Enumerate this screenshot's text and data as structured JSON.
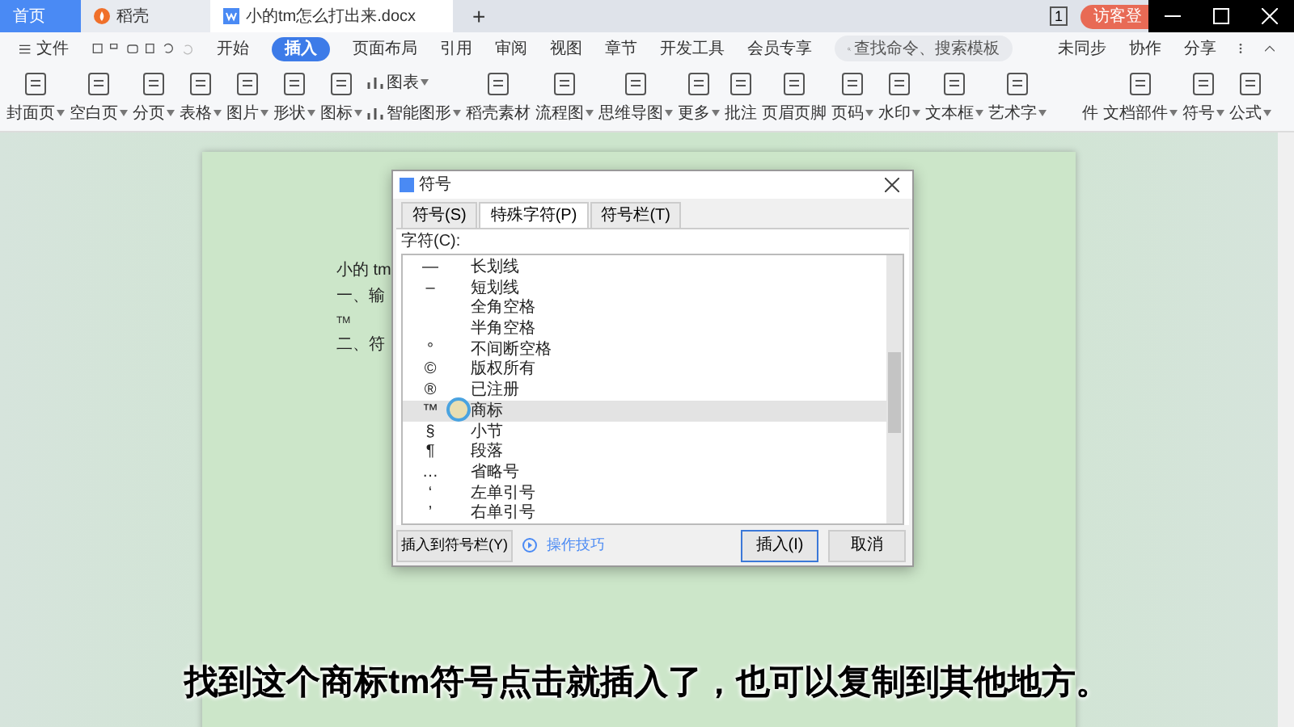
{
  "tabs": [
    {
      "label": "首页",
      "kind": "home",
      "selected": false
    },
    {
      "label": "稻壳",
      "kind": "app",
      "selected": false
    },
    {
      "label": "小的tm怎么打出来.docx",
      "kind": "doc",
      "selected": true
    }
  ],
  "new_tab": "+",
  "page_count": "1",
  "login": "访客登",
  "menu": {
    "file": "文件",
    "items": [
      {
        "label": "开始",
        "selected": false
      },
      {
        "label": "插入",
        "selected": true
      },
      {
        "label": "页面布局",
        "selected": false
      },
      {
        "label": "引用",
        "selected": false
      },
      {
        "label": "审阅",
        "selected": false
      },
      {
        "label": "视图",
        "selected": false
      },
      {
        "label": "章节",
        "selected": false
      },
      {
        "label": "开发工具",
        "selected": false
      },
      {
        "label": "会员专享",
        "selected": false
      }
    ],
    "search_placeholder": "查找命令、搜索模板",
    "sync": "未同步",
    "collab": "协作",
    "share": "分享"
  },
  "ribbon": [
    {
      "label": "封面页",
      "dropdown": true
    },
    {
      "label": "空白页",
      "dropdown": true
    },
    {
      "label": "分页",
      "dropdown": true
    },
    {
      "label": "表格",
      "dropdown": true
    },
    {
      "label": "图片",
      "dropdown": true
    },
    {
      "label": "形状",
      "dropdown": true
    },
    {
      "label": "图标",
      "dropdown": true
    },
    {
      "kind": "stack",
      "items": [
        {
          "label": "图表",
          "dropdown": true
        },
        {
          "label": "智能图形",
          "dropdown": true
        }
      ]
    },
    {
      "label": "稻壳素材",
      "dropdown": false
    },
    {
      "label": "流程图",
      "dropdown": true
    },
    {
      "label": "思维导图",
      "dropdown": true
    },
    {
      "label": "更多",
      "dropdown": true
    },
    {
      "label": "批注",
      "dropdown": false
    },
    {
      "label": "页眉页脚",
      "dropdown": false
    },
    {
      "label": "页码",
      "dropdown": true
    },
    {
      "label": "水印",
      "dropdown": true
    },
    {
      "label": "文本框",
      "dropdown": true
    },
    {
      "label": "艺术字",
      "dropdown": true
    },
    {
      "kind": "gap"
    },
    {
      "label": "件",
      "dropdown": false,
      "kind": "text"
    },
    {
      "label": "文档部件",
      "dropdown": true
    },
    {
      "label": "符号",
      "dropdown": true
    },
    {
      "label": "公式",
      "dropdown": true
    }
  ],
  "document": {
    "lines": [
      {
        "text": "小的 tm",
        "kind": "para"
      },
      {
        "text": "一、输",
        "kind": "para"
      },
      {
        "text": "TM",
        "kind": "small"
      },
      {
        "text": "二、符",
        "kind": "para"
      }
    ]
  },
  "dialog": {
    "title": "符号",
    "tabs": [
      {
        "label": "符号(S)",
        "selected": false
      },
      {
        "label": "特殊字符(P)",
        "selected": true
      },
      {
        "label": "符号栏(T)",
        "selected": false
      }
    ],
    "list_label": "字符(C):",
    "characters": [
      {
        "symbol": "—",
        "name": "长划线",
        "selected": false
      },
      {
        "symbol": "–",
        "name": "短划线",
        "selected": false
      },
      {
        "name": "全角空格",
        "selected": false
      },
      {
        "name": "半角空格",
        "selected": false
      },
      {
        "symbol": "°",
        "name": "不间断空格",
        "selected": false
      },
      {
        "symbol": "©",
        "name": "版权所有",
        "selected": false
      },
      {
        "symbol": "®",
        "name": "已注册",
        "selected": false
      },
      {
        "symbol": "™",
        "name": "商标",
        "selected": true
      },
      {
        "symbol": "§",
        "name": "小节",
        "selected": false
      },
      {
        "symbol": "¶",
        "name": "段落",
        "selected": false
      },
      {
        "symbol": "…",
        "name": "省略号",
        "selected": false
      },
      {
        "symbol": "‘",
        "name": "左单引号",
        "selected": false
      },
      {
        "symbol": "’",
        "name": "右单引号",
        "selected": false
      }
    ],
    "add_button": "插入到符号栏(Y)",
    "tips_link": "操作技巧",
    "insert_button": "插入(I)",
    "cancel_button": "取消"
  },
  "caption": "找到这个商标tm符号点击就插入了，也可以复制到其他地方。"
}
